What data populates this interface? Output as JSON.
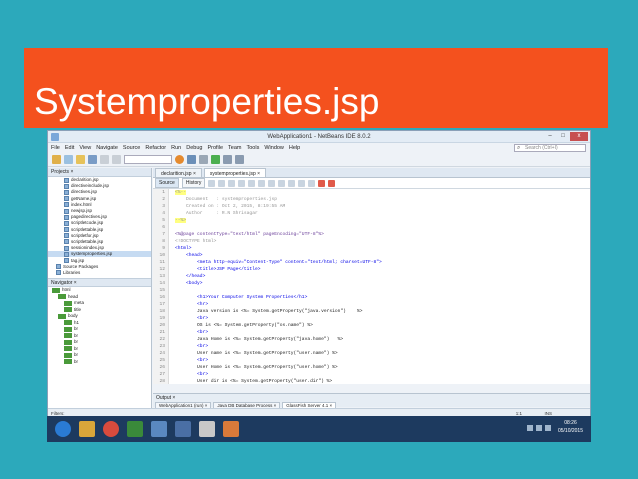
{
  "slide": {
    "title": "Systemproperties.jsp",
    "accent_color": "#f4511e",
    "background_color": "#2ca9bb"
  },
  "window": {
    "title": "WebApplication1 - NetBeans IDE 8.0.2",
    "controls": [
      "–",
      "□",
      "x"
    ]
  },
  "menu": [
    "File",
    "Edit",
    "View",
    "Navigate",
    "Source",
    "Refactor",
    "Run",
    "Debug",
    "Profile",
    "Team",
    "Tools",
    "Window",
    "Help"
  ],
  "search": {
    "placeholder": "Search (Ctrl+I)"
  },
  "projects_pane": {
    "header": "Projects ×",
    "files": [
      "declarition.jsp",
      "directiveinclude.jsp",
      "directives.jsp",
      "getName.jsp",
      "index.html",
      "newjsp.jsp",
      "pagedirectives.jsp",
      "scriptletcode.jsp",
      "scriptlettable.jsp",
      "scriptletfor.jsp",
      "scriptlettable.jsp",
      "sessionindex.jsp",
      "systemproperties.jsp",
      "tag.jsp",
      "Source Packages",
      "Libraries"
    ],
    "selected_index": 12
  },
  "navigator_pane": {
    "header": "Navigator ×",
    "items": [
      "html",
      "head",
      "meta",
      "title",
      "body",
      "h1",
      "br",
      "br",
      "br",
      "br",
      "br",
      "br"
    ]
  },
  "editor": {
    "tabs": [
      "declarition.jsp ×",
      "systemproperties.jsp ×"
    ],
    "view_tabs": [
      "Source",
      "History"
    ],
    "lines": [
      {
        "n": "1",
        "text": "<%--",
        "cls": "c-comment",
        "hl": true
      },
      {
        "n": "2",
        "text": "    Document   : systemproperties.jsp",
        "cls": "c-comment"
      },
      {
        "n": "3",
        "text": "    Created on : Oct 2, 2015, 8:19:55 AM",
        "cls": "c-comment"
      },
      {
        "n": "4",
        "text": "    Author     : R.N Shrisagar",
        "cls": "c-comment"
      },
      {
        "n": "5",
        "text": "--%>",
        "cls": "c-comment",
        "hl": true
      },
      {
        "n": "6",
        "text": "",
        "cls": "c-text"
      },
      {
        "n": "7",
        "text": "<%@page contentType=\"text/html\" pageEncoding=\"UTF-8\"%>",
        "cls": "c-dir"
      },
      {
        "n": "8",
        "text": "<!DOCTYPE html>",
        "cls": "c-comment"
      },
      {
        "n": "9",
        "text": "<html>",
        "cls": "c-tag"
      },
      {
        "n": "10",
        "text": "    <head>",
        "cls": "c-tag"
      },
      {
        "n": "11",
        "text": "        <meta http-equiv=\"Content-Type\" content=\"text/html; charset=UTF-8\">",
        "cls": "c-tag"
      },
      {
        "n": "12",
        "text": "        <title>JSP Page</title>",
        "cls": "c-tag"
      },
      {
        "n": "13",
        "text": "    </head>",
        "cls": "c-tag"
      },
      {
        "n": "14",
        "text": "    <body>",
        "cls": "c-tag"
      },
      {
        "n": "15",
        "text": "",
        "cls": "c-text"
      },
      {
        "n": "16",
        "text": "        <h1>Your Computer System Properties</h1>",
        "cls": "c-tag"
      },
      {
        "n": "17",
        "text": "        <hr>",
        "cls": "c-tag"
      },
      {
        "n": "18",
        "text": "        Java version is <%= System.getProperty(\"java.version\")    %>",
        "cls": "c-text"
      },
      {
        "n": "19",
        "text": "        <br>",
        "cls": "c-tag"
      },
      {
        "n": "20",
        "text": "        OS is <%= System.getProperty(\"os.name\") %>",
        "cls": "c-text"
      },
      {
        "n": "21",
        "text": "        <br>",
        "cls": "c-tag"
      },
      {
        "n": "22",
        "text": "        Java Home is <%= System.getProperty(\"java.home\")   %>",
        "cls": "c-text"
      },
      {
        "n": "23",
        "text": "        <br>",
        "cls": "c-tag"
      },
      {
        "n": "24",
        "text": "        User name is <%= System.getProperty(\"user.name\") %>",
        "cls": "c-text"
      },
      {
        "n": "25",
        "text": "        <br>",
        "cls": "c-tag"
      },
      {
        "n": "26",
        "text": "        User Home is <%= System.getProperty(\"user.home\") %>",
        "cls": "c-text"
      },
      {
        "n": "27",
        "text": "        <br>",
        "cls": "c-tag"
      },
      {
        "n": "28",
        "text": "        User dir is <%= System.getProperty(\"user.dir\") %>",
        "cls": "c-text"
      }
    ]
  },
  "output": {
    "label": "Output ×",
    "tabs": [
      "WebApplication1 (run) ×",
      "Java DB Database Process ×",
      "GlassFish Server 4.1 ×"
    ]
  },
  "status": {
    "filter": "Filters:",
    "position": "1:1",
    "mode": "INS"
  },
  "taskbar": {
    "time": "08:26",
    "date": "05/10/2015"
  }
}
